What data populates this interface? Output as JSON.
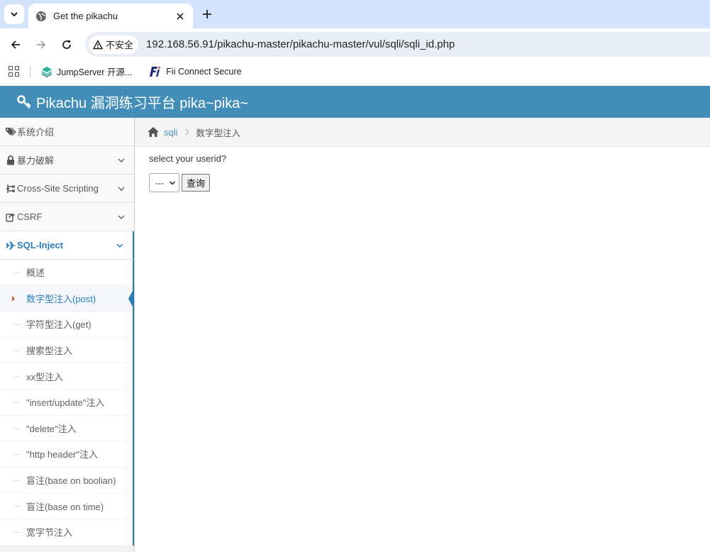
{
  "browser": {
    "tab_title": "Get the pikachu",
    "security_label": "不安全",
    "url": "192.168.56.91/pikachu-master/pikachu-master/vul/sqli/sqli_id.php",
    "bookmarks": [
      {
        "label": "JumpServer 开源...",
        "icon": "jumpserver-icon"
      },
      {
        "label": "Fii Connect Secure",
        "icon": "fii-icon"
      }
    ]
  },
  "header": {
    "title": "Pikachu 漏洞练习平台 pika~pika~",
    "icon": "key-icon"
  },
  "sidebar": {
    "items": [
      {
        "label": "系统介绍",
        "icon": "tags-icon"
      },
      {
        "label": "暴力破解",
        "icon": "lock-icon"
      },
      {
        "label": "Cross-Site Scripting",
        "icon": "sitemap-icon"
      },
      {
        "label": "CSRF",
        "icon": "share-icon"
      },
      {
        "label": "SQL-Inject",
        "icon": "plane-icon"
      }
    ],
    "submenu": [
      {
        "label": "概述"
      },
      {
        "label": "数字型注入(post)"
      },
      {
        "label": "字符型注入(get)"
      },
      {
        "label": "搜索型注入"
      },
      {
        "label": "xx型注入"
      },
      {
        "label": "\"insert/update\"注入"
      },
      {
        "label": "\"delete\"注入"
      },
      {
        "label": "\"http header\"注入"
      },
      {
        "label": "盲注(base on boolian)"
      },
      {
        "label": "盲注(base on time)"
      },
      {
        "label": "宽字节注入"
      }
    ]
  },
  "breadcrumb": {
    "link": "sqli",
    "current": "数字型注入"
  },
  "main": {
    "prompt": "select your userid?",
    "select_value": "---",
    "submit_label": "查询"
  },
  "colors": {
    "header_bg": "#438eb9",
    "accent": "#2b7dbc",
    "tabstrip_bg": "#d3e3fd"
  }
}
